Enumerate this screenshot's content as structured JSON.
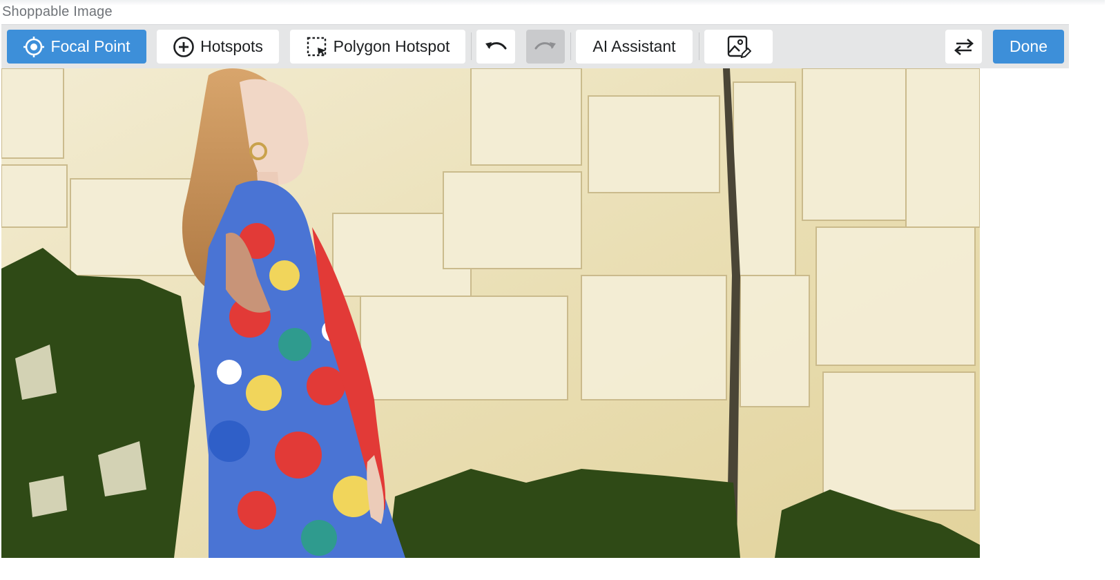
{
  "field": {
    "label": "Shoppable Image"
  },
  "toolbar": {
    "focal_point_label": "Focal Point",
    "focal_point_icon": "crosshair-icon",
    "hotspots_label": "Hotspots",
    "hotspots_icon": "plus-circle-icon",
    "polygon_hotspot_label": "Polygon Hotspot",
    "polygon_hotspot_icon": "dashed-square-cursor-icon",
    "undo_icon": "undo-icon",
    "redo_icon": "redo-icon",
    "redo_state": "disabled",
    "ai_assistant_label": "AI Assistant",
    "image_edit_icon": "image-edit-icon",
    "swap_icon": "swap-arrows-icon",
    "done_label": "Done"
  },
  "colors": {
    "primary": "#3d8fd9",
    "toolbar_bg": "#e5e6e7",
    "disabled": "#c9cacc"
  },
  "image": {
    "subject": "Woman in floral dress leaning against a white chalk cliff with green algae"
  }
}
